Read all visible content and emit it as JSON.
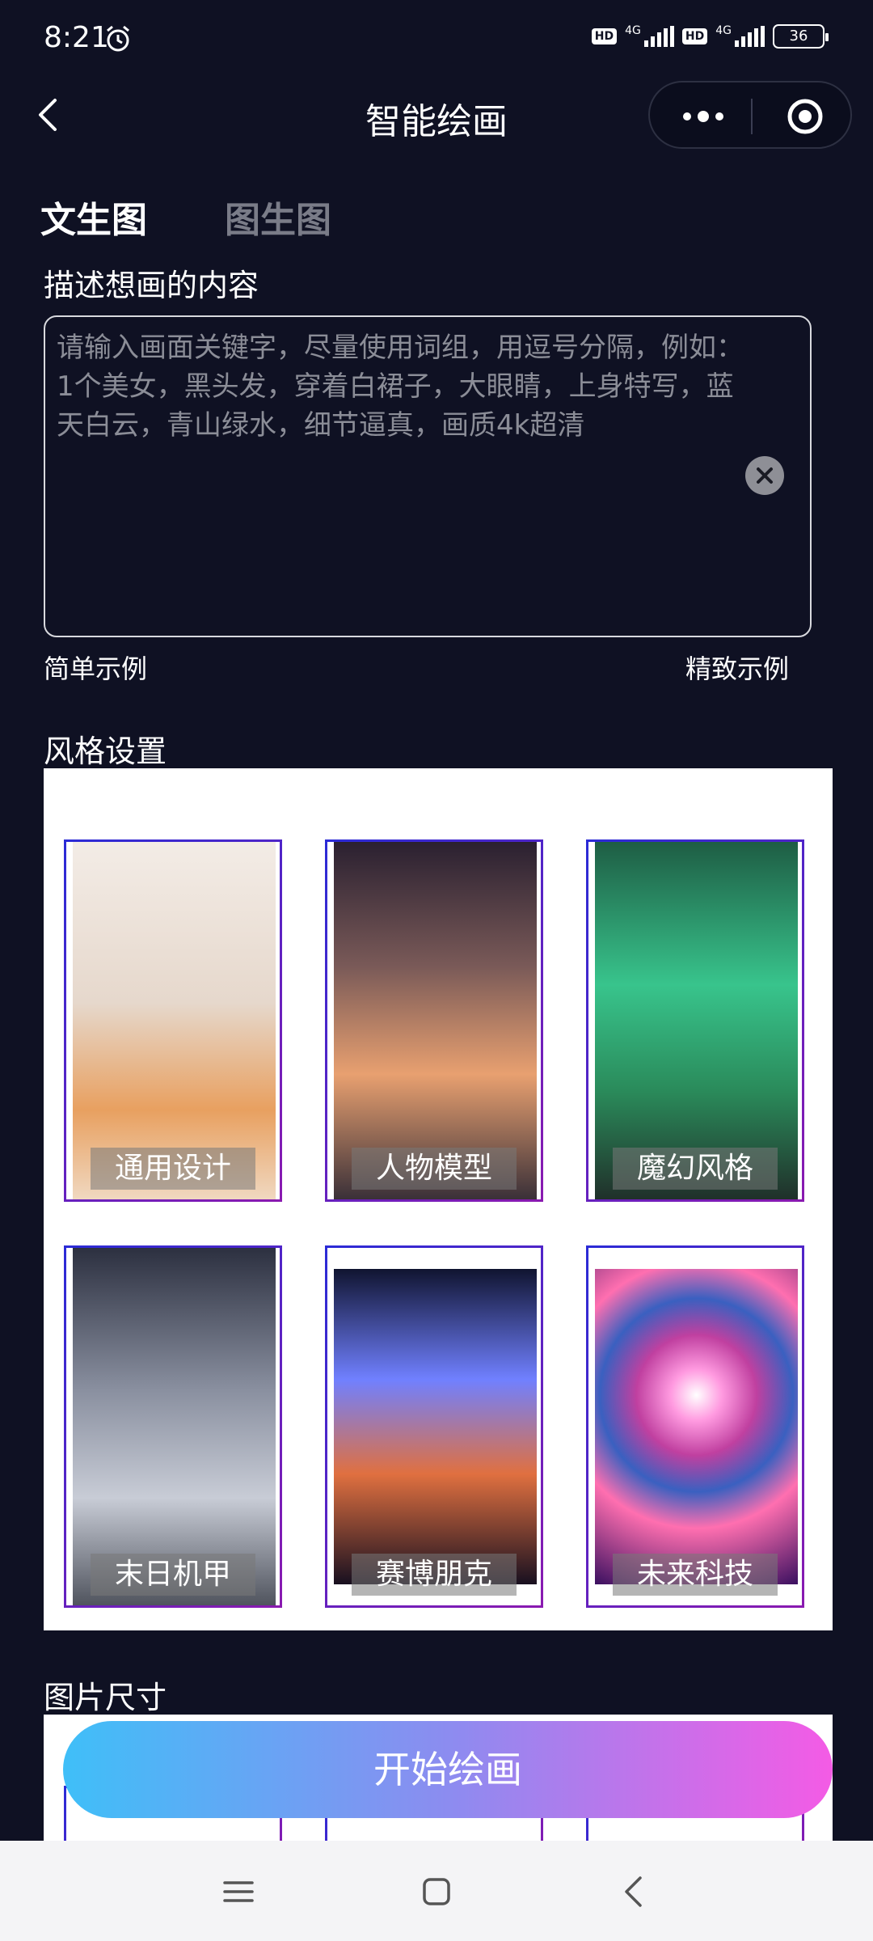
{
  "status": {
    "time": "8:21",
    "network1": "4G",
    "network2": "4G",
    "hd": "HD",
    "battery": "36"
  },
  "header": {
    "title": "智能绘画"
  },
  "tabs": [
    {
      "label": "文生图",
      "active": true
    },
    {
      "label": "图生图",
      "active": false
    }
  ],
  "prompt": {
    "label": "描述想画的内容",
    "placeholder": "请输入画面关键字，尽量使用词组，用逗号分隔，例如：1个美女，黑头发，穿着白裙子，大眼睛，上身特写，蓝天白云，青山绿水，细节逼真，画质4k超清",
    "simple_example": "简单示例",
    "fine_example": "精致示例"
  },
  "style": {
    "label": "风格设置",
    "items": [
      {
        "label": "通用设计",
        "colors": [
          "#f3ece6",
          "#e8a060"
        ]
      },
      {
        "label": "人物模型",
        "colors": [
          "#2a2030",
          "#e8a070"
        ]
      },
      {
        "label": "魔幻风格",
        "colors": [
          "#1e5d44",
          "#38c48c"
        ]
      },
      {
        "label": "末日机甲",
        "colors": [
          "#2c3040",
          "#c8ccd6"
        ]
      },
      {
        "label": "赛博朋克",
        "colors": [
          "#101430",
          "#7080ff"
        ]
      },
      {
        "label": "未来科技",
        "colors": [
          "#3a1060",
          "#ff6fb0"
        ]
      }
    ]
  },
  "size": {
    "label": "图片尺寸"
  },
  "action": {
    "start_label": "开始绘画"
  },
  "colors": {
    "background": "#0f1123",
    "accent_start": "#3fbff8",
    "accent_end": "#f45be5"
  }
}
